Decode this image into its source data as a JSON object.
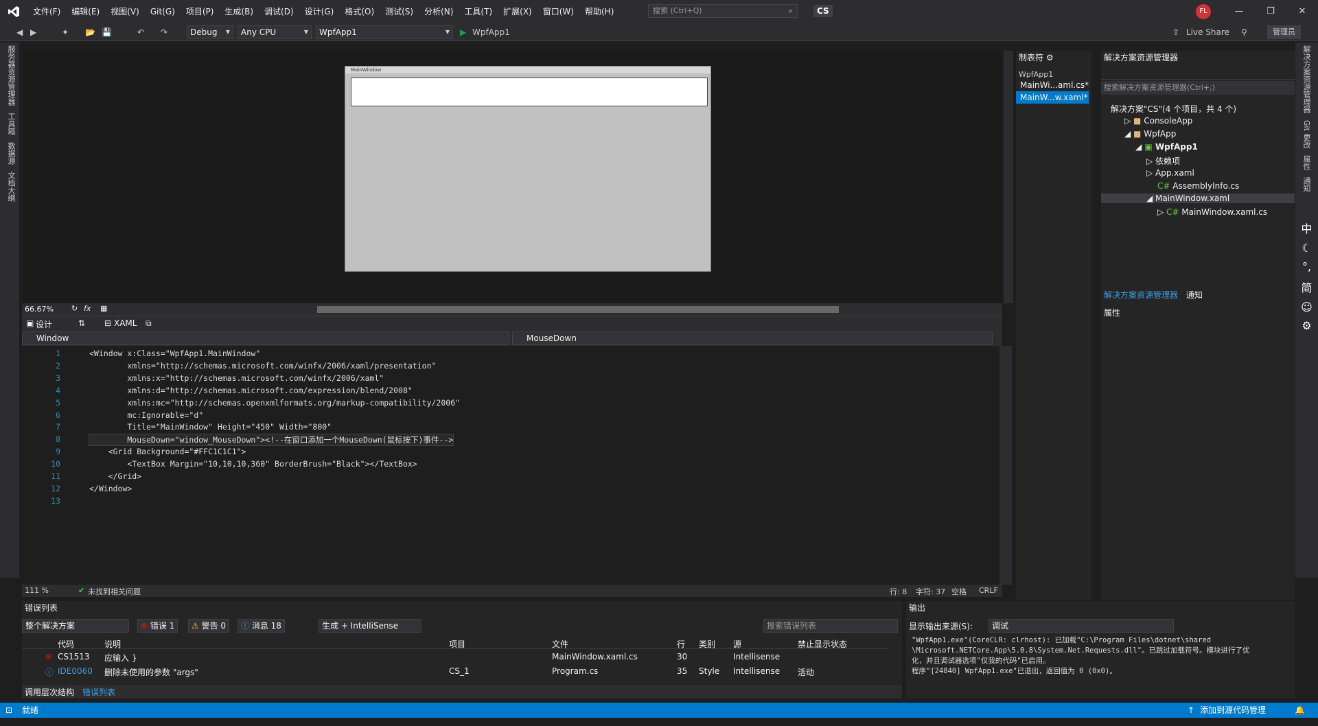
{
  "menu": {
    "items": [
      "文件(F)",
      "编辑(E)",
      "视图(V)",
      "Git(G)",
      "项目(P)",
      "生成(B)",
      "调试(D)",
      "设计(G)",
      "格式(O)",
      "测试(S)",
      "分析(N)",
      "工具(T)",
      "扩展(X)",
      "窗口(W)",
      "帮助(H)"
    ],
    "search_placeholder": "搜索 (Ctrl+Q)",
    "app_name": "CS",
    "avatar": "FL"
  },
  "toolbar": {
    "config": "Debug",
    "platform": "Any CPU",
    "project": "WpfApp1",
    "run": "WpfApp1",
    "live_share": "Live Share",
    "admin": "管理员"
  },
  "left_strip": [
    "服务器资源管理器",
    "工具箱",
    "数据源",
    "文档大纲"
  ],
  "right_strip": [
    "解决方案资源管理器",
    "Git 更改",
    "属性",
    "通知"
  ],
  "designer": {
    "window_title": "MainWindow",
    "zoom": "66.67%"
  },
  "editor_tabs": {
    "design": "设计",
    "xaml": "XAML",
    "element": "Window",
    "event": "MouseDown"
  },
  "code": {
    "lines": [
      {
        "n": "1",
        "t": "<Window x:Class=\"WpfApp1.MainWindow\""
      },
      {
        "n": "2",
        "t": "        xmlns=\"http://schemas.microsoft.com/winfx/2006/xaml/presentation\""
      },
      {
        "n": "3",
        "t": "        xmlns:x=\"http://schemas.microsoft.com/winfx/2006/xaml\""
      },
      {
        "n": "4",
        "t": "        xmlns:d=\"http://schemas.microsoft.com/expression/blend/2008\""
      },
      {
        "n": "5",
        "t": "        xmlns:mc=\"http://schemas.openxmlformats.org/markup-compatibility/2006\""
      },
      {
        "n": "6",
        "t": "        mc:Ignorable=\"d\""
      },
      {
        "n": "7",
        "t": "        Title=\"MainWindow\" Height=\"450\" Width=\"800\""
      },
      {
        "n": "8",
        "t": "        MouseDown=\"window_MouseDown\"><!--在窗口添加一个MouseDown(鼠标按下)事件-->"
      },
      {
        "n": "9",
        "t": "    <Grid Background=\"#FFC1C1C1\">"
      },
      {
        "n": "10",
        "t": "        <TextBox Margin=\"10,10,10,360\" BorderBrush=\"Black\"></TextBox>"
      },
      {
        "n": "11",
        "t": "    </Grid>"
      },
      {
        "n": "12",
        "t": "</Window>"
      },
      {
        "n": "13",
        "t": ""
      }
    ]
  },
  "code_status": {
    "zoom": "111 %",
    "issues": "未找到相关问题",
    "line": "行: 8",
    "char": "字符: 37",
    "space": "空格",
    "eol": "CRLF"
  },
  "tabs_panel": {
    "title": "制表符",
    "group": "WpfApp1",
    "items": [
      "MainWi...aml.cs*",
      "MainW...w.xaml*"
    ]
  },
  "solution": {
    "title": "解决方案资源管理器",
    "search": "搜索解决方案资源管理器(Ctrl+;)",
    "root": "解决方案\"CS\"(4 个项目，共 4 个)",
    "nodes": [
      "ConsoleApp",
      "WpfApp",
      "WpfApp1",
      "依赖项",
      "App.xaml",
      "AssemblyInfo.cs",
      "MainWindow.xaml",
      "MainWindow.xaml.cs"
    ],
    "tab1": "解决方案资源管理器",
    "tab2": "通知",
    "props": "属性"
  },
  "errors": {
    "title": "错误列表",
    "scope": "整个解决方案",
    "err": "错误 1",
    "warn": "警告 0",
    "msg": "消息 18",
    "build": "生成 + IntelliSense",
    "search": "搜索错误列表",
    "headers": [
      "代码",
      "说明",
      "项目",
      "文件",
      "行",
      "类别",
      "源",
      "禁止显示状态"
    ],
    "rows": [
      {
        "code": "CS1513",
        "desc": "应输入 }",
        "proj": "",
        "file": "MainWindow.xaml.cs",
        "line": "30",
        "cat": "",
        "src": "Intellisense",
        "sup": ""
      },
      {
        "code": "IDE0060",
        "desc": "删除未使用的参数 \"args\"",
        "proj": "CS_1",
        "file": "Program.cs",
        "line": "35",
        "cat": "Style",
        "src": "Intellisense",
        "sup": "活动"
      }
    ]
  },
  "output": {
    "title": "输出",
    "source_label": "显示输出来源(S):",
    "source": "调试",
    "lines": [
      "\"WpfApp1.exe\"(CoreCLR: clrhost): 已加载\"C:\\Program Files\\dotnet\\shared",
      "\\Microsoft.NETCore.App\\5.0.8\\System.Net.Requests.dll\"。已跳过加载符号。模块进行了优",
      "化，并且调试器选项\"仅我的代码\"已启用。",
      "程序\"[24840] WpfApp1.exe\"已退出，返回值为 0 (0x0)。"
    ]
  },
  "bottom_tabs": [
    "调用层次结构",
    "错误列表"
  ],
  "status": {
    "ready": "就绪",
    "source_control": "添加到源代码管理"
  }
}
